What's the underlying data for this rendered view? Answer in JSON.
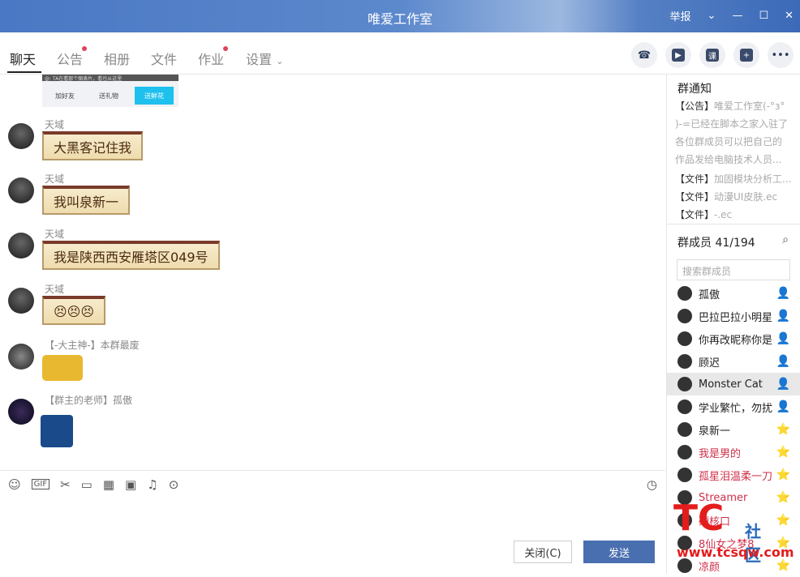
{
  "window": {
    "title": "唯爱工作室",
    "report": "举报",
    "icons": [
      "chevron-down-icon",
      "minimize-icon",
      "maximize-icon",
      "close-icon"
    ]
  },
  "tabs": [
    {
      "label": "聊天",
      "active": true
    },
    {
      "label": "公告",
      "dot": true
    },
    {
      "label": "相册"
    },
    {
      "label": "文件"
    },
    {
      "label": "作业",
      "dot": true
    },
    {
      "label": "设置",
      "chevron": true
    }
  ],
  "tools": {
    "phone": "☎",
    "video": "▶",
    "course": "课",
    "add": "+",
    "more": "•••"
  },
  "card": {
    "bar_text": "@: TA在看那个图表片，看也从这里",
    "add_friend": "加好友",
    "gift": "送礼物",
    "third": "送鲜花"
  },
  "messages": [
    {
      "name": "天域",
      "text": "大黑客记住我"
    },
    {
      "name": "天域",
      "text": "我叫泉新一"
    },
    {
      "name": "天域",
      "text": "我是陕西西安雁塔区049号"
    },
    {
      "name": "天域",
      "text": "😣😣😣"
    },
    {
      "name": "【-大主神-】本群最废",
      "text": ""
    },
    {
      "name": "【群主的老师】孤傲",
      "text": ""
    }
  ],
  "toolbar": {
    "icons": [
      "smiley-icon",
      "gif-icon",
      "scissors-icon",
      "folder-icon",
      "doc-icon",
      "image-icon",
      "bell-icon",
      "more-icon",
      "clock-icon"
    ]
  },
  "buttons": {
    "close": "关闭(C)",
    "send": "发送"
  },
  "notice": {
    "title": "群通知",
    "items": [
      {
        "tag": "【公告】",
        "text": "唯爱工作室(-°з°"
      },
      {
        "tag": "",
        "text": ")-=已经在脚本之家入驻了"
      },
      {
        "tag": "",
        "text": "各位群成员可以把自己的"
      },
      {
        "tag": "",
        "text": "作品发给电脑技术人员..."
      },
      {
        "tag": "【文件】",
        "text": "加固模块分析工..."
      },
      {
        "tag": "【文件】",
        "text": "动漫UI皮肤.ec"
      },
      {
        "tag": "【文件】",
        "text": "-.ec"
      }
    ]
  },
  "members": {
    "title": "群成员 41/194",
    "search_placeholder": "搜索群成员",
    "list": [
      {
        "name": "孤傲",
        "color": "#222",
        "badge": "owner"
      },
      {
        "name": "巴拉巴拉小明星",
        "color": "#222",
        "badge": "admin"
      },
      {
        "name": "你再改昵称你是",
        "color": "#222",
        "badge": "admin"
      },
      {
        "name": "顾迟",
        "color": "#222",
        "badge": "admin"
      },
      {
        "name": "Monster Cat",
        "color": "#222",
        "badge": "admin",
        "selected": true
      },
      {
        "name": "学业繁忙，勿扰",
        "color": "#222",
        "badge": "admin"
      },
      {
        "name": "泉新一",
        "color": "#222",
        "badge": "star"
      },
      {
        "name": "我是男的",
        "color": "#d0304a",
        "badge": "star"
      },
      {
        "name": "孤星泪温柔一刀",
        "color": "#d0304a",
        "badge": "star"
      },
      {
        "name": "Streamer",
        "color": "#d0304a",
        "badge": "star"
      },
      {
        "name": "硬核口",
        "color": "#d0304a",
        "badge": "star"
      },
      {
        "name": "8仙女之梦8",
        "color": "#d0304a",
        "badge": "star"
      },
      {
        "name": "凉颜",
        "color": "#d0304a",
        "badge": "star"
      }
    ]
  },
  "watermark": {
    "logo": "TC",
    "text": "社区",
    "url": "www.tcsqw.com"
  }
}
